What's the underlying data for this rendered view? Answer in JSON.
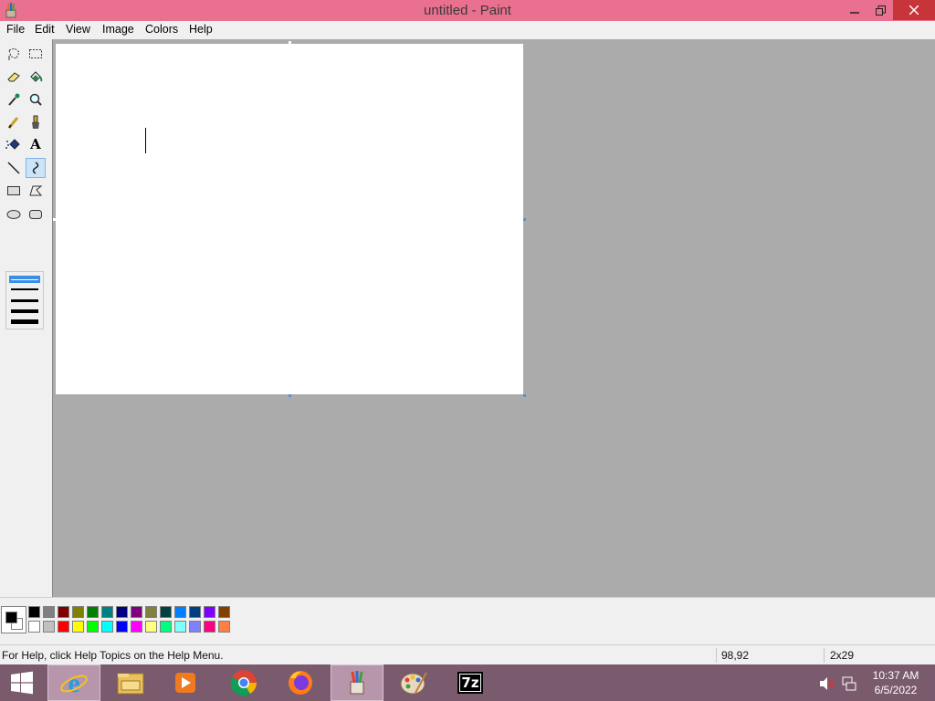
{
  "window": {
    "title": "untitled - Paint"
  },
  "menu": [
    "File",
    "Edit",
    "View",
    "Image",
    "Colors",
    "Help"
  ],
  "tools": [
    [
      "free-form-select-icon",
      "select-icon"
    ],
    [
      "eraser-icon",
      "fill-icon"
    ],
    [
      "pick-color-icon",
      "magnifier-icon"
    ],
    [
      "pencil-icon",
      "brush-icon"
    ],
    [
      "airbrush-icon",
      "text-icon"
    ],
    [
      "line-icon",
      "curve-icon"
    ],
    [
      "rectangle-icon",
      "polygon-icon"
    ],
    [
      "ellipse-icon",
      "rounded-rectangle-icon"
    ]
  ],
  "selected_tool": "curve-icon",
  "text_tool_glyph": "A",
  "current_colors": {
    "foreground": "#000000",
    "background": "#ffffff"
  },
  "palette": {
    "top": [
      "#000000",
      "#808080",
      "#800000",
      "#808000",
      "#008000",
      "#008080",
      "#000080",
      "#800080",
      "#808040",
      "#004040",
      "#0080ff",
      "#004080",
      "#8000ff",
      "#804000"
    ],
    "bottom": [
      "#ffffff",
      "#c0c0c0",
      "#ff0000",
      "#ffff00",
      "#00ff00",
      "#00ffff",
      "#0000ff",
      "#ff00ff",
      "#ffff80",
      "#00ff80",
      "#80ffff",
      "#8080ff",
      "#ff0080",
      "#ff8040"
    ]
  },
  "status": {
    "help": "For Help, click Help Topics on the Help Menu.",
    "coords": "98,92",
    "size": "2x29"
  },
  "taskbar": {
    "items": [
      "start-icon",
      "internet-explorer-icon",
      "file-explorer-icon",
      "media-player-icon",
      "chrome-icon",
      "firefox-icon",
      "paint-icon",
      "paint-palette-icon",
      "7zip-icon"
    ],
    "sevenzip_label": "7z",
    "time": "10:37 AM",
    "date": "6/5/2022"
  }
}
